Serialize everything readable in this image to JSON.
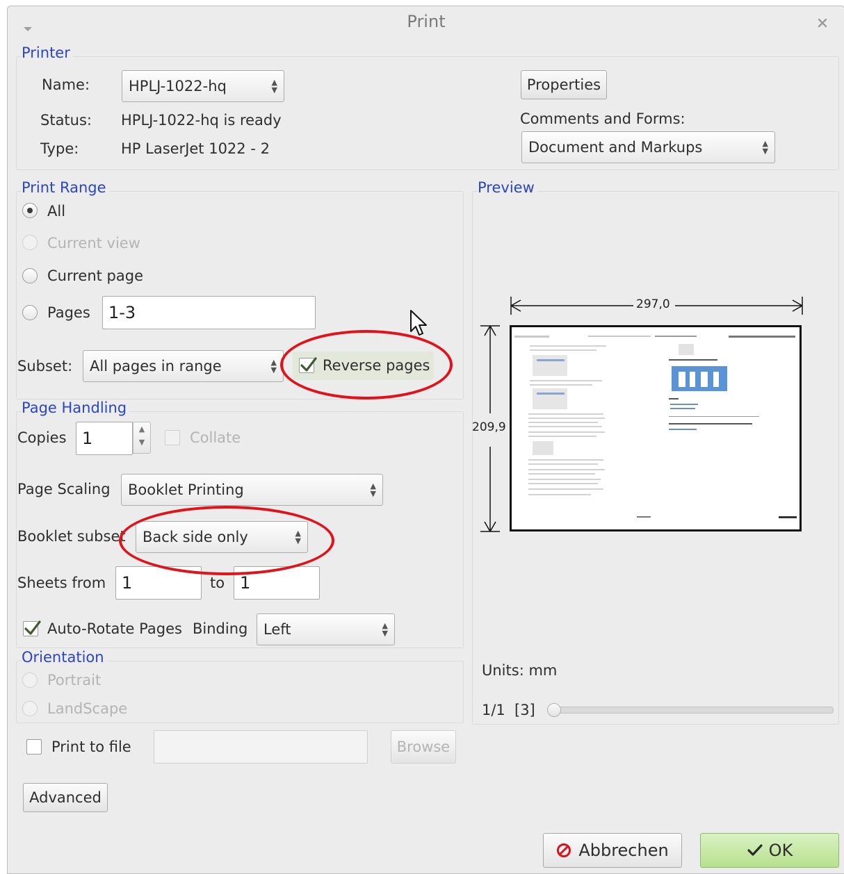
{
  "window": {
    "title": "Print",
    "menu_icon": "chevron-down-icon",
    "close_icon": "close-icon"
  },
  "printer": {
    "section_label": "Printer",
    "name_label": "Name:",
    "name_value": "HPLJ-1022-hq",
    "status_label": "Status:",
    "status_value": "HPLJ-1022-hq is ready",
    "type_label": "Type:",
    "type_value": "HP LaserJet 1022 -  2",
    "properties_button": "Properties",
    "comments_label": "Comments and Forms:",
    "comments_value": "Document and Markups"
  },
  "print_range": {
    "section_label": "Print Range",
    "all_label": "All",
    "all_selected": true,
    "current_view_label": "Current view",
    "current_view_enabled": false,
    "current_page_label": "Current page",
    "pages_label": "Pages",
    "pages_value": "1-3",
    "subset_label": "Subset:",
    "subset_value": "All pages in range",
    "reverse_label": "Reverse pages",
    "reverse_checked": true
  },
  "page_handling": {
    "section_label": "Page Handling",
    "copies_label": "Copies",
    "copies_value": "1",
    "collate_label": "Collate",
    "collate_enabled": false,
    "scaling_label": "Page Scaling",
    "scaling_value": "Booklet Printing",
    "booklet_label": "Booklet subset",
    "booklet_value": "Back side only",
    "sheets_from_label": "Sheets from",
    "sheets_from_value": "1",
    "to_label": "to",
    "sheets_to_value": "1",
    "autorotate_label": "Auto-Rotate Pages",
    "autorotate_checked": true,
    "binding_label": "Binding",
    "binding_value": "Left"
  },
  "orientation": {
    "section_label": "Orientation",
    "portrait_label": "Portrait",
    "landscape_label": "LandScape",
    "enabled": false
  },
  "output": {
    "print_to_file_label": "Print to file",
    "print_to_file_checked": false,
    "file_path": "",
    "browse_button": "Browse",
    "advanced_button": "Advanced"
  },
  "preview": {
    "section_label": "Preview",
    "width_label": "297,0",
    "height_label": "209,9",
    "units_label": "Units: mm",
    "page_indicator": "1/1",
    "page_count": "[3]"
  },
  "actions": {
    "cancel_label": "Abbrechen",
    "ok_label": "OK",
    "cancel_icon": "cancel-icon",
    "ok_icon": "checkmark-icon"
  },
  "colors": {
    "section_heading": "#2a45c7",
    "annotation": "#e0121a",
    "ok_button": "#c6e8a8"
  }
}
